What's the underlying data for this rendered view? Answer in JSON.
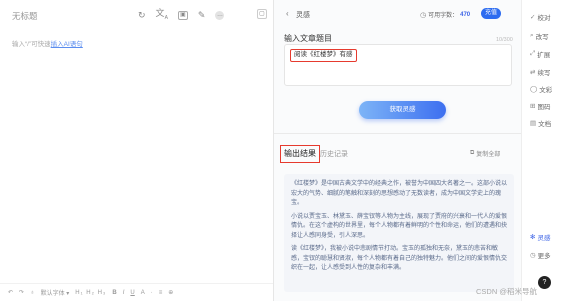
{
  "editor": {
    "doc_title": "无标题",
    "hint_prefix": "输入“/”可快速",
    "hint_link": "插入AI语句",
    "toolbar_icons": [
      "undo-icon",
      "translate-icon",
      "image-icon",
      "pen-icon",
      "more-icon"
    ],
    "bottom_bar": {
      "undo": "↶",
      "redo": "↷",
      "paint": "♁",
      "text_style": "默认字体 ▾",
      "headings": "H₁ H₂ H₃",
      "bold": "B",
      "italic": "I",
      "underline": "U",
      "font_color": "A",
      "divider": "·",
      "align": "≡",
      "zoom": "⊕"
    }
  },
  "panel": {
    "back_icon": "‹",
    "title": "灵感",
    "word_count_label": "可用字数：",
    "word_count_value": "470",
    "vip_label": "充值",
    "section_label": "输入文章题目",
    "char_limit": "10/300",
    "input_value": "阅读《红楼梦》有感",
    "generate_button": "获取灵感",
    "tab_output": "输出结果",
    "tab_history": "历史记录",
    "copy_all": "复制全部",
    "output_paragraphs": [
      "《红楼梦》是中国古典文学中的经典之作，被誉为中国四大名著之一。这部小说以宏大的气势、细腻的笔触和深刻的思想感动了无数读者，成为中国文学史上的瑰宝。",
      "小说以贾宝玉、林黛玉、薛宝钗等人物为主线，展现了贾府的兴衰和一代人的爱恨情仇。在这个虚构的世界里，每个人物都有着鲜明的个性和命运，他们的遭遇和抉择让人感同身受，引人深思。",
      "读《红楼梦》，我被小说中悲剧情节打动。宝玉的孤独和无奈，黛玉的悲苦和敏感，宝钗的聪慧和贤淑，每个人物都有着自己的独特魅力。他们之间的爱恨情仇交织在一起，让人感受到人性的复杂和丰满。"
    ]
  },
  "right_bar": {
    "items": [
      {
        "icon": "✓",
        "label": "校对"
      },
      {
        "icon": "⌕",
        "label": "改写"
      },
      {
        "icon": "⤢",
        "label": "扩展"
      },
      {
        "icon": "⇄",
        "label": "续写"
      },
      {
        "icon": "◯",
        "label": "文彩"
      },
      {
        "icon": "⊞",
        "label": "图码"
      },
      {
        "icon": "▤",
        "label": "文档"
      },
      {
        "icon": "✻",
        "label": "灵感"
      },
      {
        "icon": "◷",
        "label": "更多"
      }
    ],
    "help": "?"
  },
  "watermark": "CSDN @稻米导航",
  "colors": {
    "accent": "#3c63e6",
    "highlight_border": "#e63a2e",
    "output_bg": "#f3f5f9",
    "button_gradient_start": "#7db4f7",
    "button_gradient_end": "#3d6ff0"
  }
}
